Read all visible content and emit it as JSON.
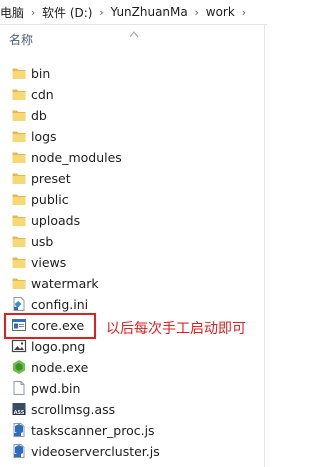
{
  "breadcrumb": {
    "items": [
      "电脑",
      "软件 (D:)",
      "YunZhuanMa",
      "work"
    ]
  },
  "header": {
    "name_label": "名称"
  },
  "files": [
    {
      "name": "bin",
      "icon": "folder-icon"
    },
    {
      "name": "cdn",
      "icon": "folder-icon"
    },
    {
      "name": "db",
      "icon": "folder-icon"
    },
    {
      "name": "logs",
      "icon": "folder-icon"
    },
    {
      "name": "node_modules",
      "icon": "folder-icon"
    },
    {
      "name": "preset",
      "icon": "folder-icon"
    },
    {
      "name": "public",
      "icon": "folder-icon"
    },
    {
      "name": "uploads",
      "icon": "folder-icon"
    },
    {
      "name": "usb",
      "icon": "folder-icon"
    },
    {
      "name": "views",
      "icon": "folder-icon"
    },
    {
      "name": "watermark",
      "icon": "folder-icon"
    },
    {
      "name": "config.ini",
      "icon": "ini-file-icon"
    },
    {
      "name": "core.exe",
      "icon": "exe-window-icon"
    },
    {
      "name": "logo.png",
      "icon": "image-file-icon"
    },
    {
      "name": "node.exe",
      "icon": "nodejs-icon"
    },
    {
      "name": "pwd.bin",
      "icon": "blank-file-icon"
    },
    {
      "name": "scrollmsg.ass",
      "icon": "ass-file-icon"
    },
    {
      "name": "taskscanner_proc.js",
      "icon": "js-file-icon"
    },
    {
      "name": "videoservercluster.js",
      "icon": "js-file-icon"
    }
  ],
  "annotation": {
    "text": "以后每次手工启动即可",
    "color": "#e02020"
  },
  "colors": {
    "folder": "#f8d775",
    "folder_dark": "#e0b24a",
    "header_text": "#4c607a",
    "highlight": "#e02020"
  }
}
